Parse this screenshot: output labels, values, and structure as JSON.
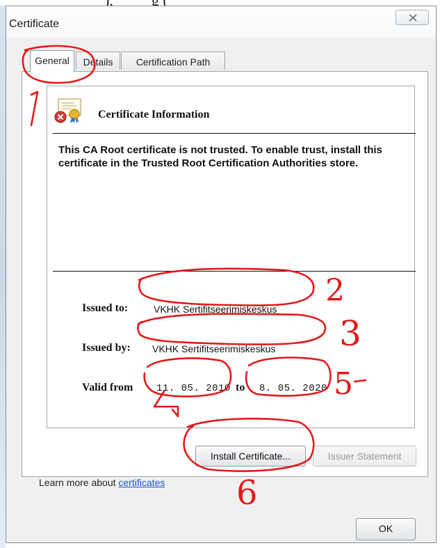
{
  "window": {
    "title": "Certificate"
  },
  "tabs": [
    {
      "label": "General",
      "active": true
    },
    {
      "label": "Details",
      "active": false
    },
    {
      "label": "Certification Path",
      "active": false
    }
  ],
  "info": {
    "heading": "Certificate Information",
    "message": "This CA Root certificate is not trusted. To enable trust, install this certificate in the Trusted Root Certification Authorities store."
  },
  "fields": {
    "issued_to_label": "Issued to:",
    "issued_to_value": "VKHK Sertifitseerimiskeskus",
    "issued_by_label": "Issued by:",
    "issued_by_value": "VKHK Sertifitseerimiskeskus",
    "valid_from_label": "Valid from",
    "valid_from_value": "11. 05. 2010",
    "valid_to_label": "to",
    "valid_to_value": "8. 05. 2020"
  },
  "buttons": {
    "install_label": "Install Certificate...",
    "issuer_statement_label": "Issuer Statement",
    "ok_label": "OK"
  },
  "learn_more": {
    "prefix": "Learn more about ",
    "link_text": "certificates"
  },
  "annotations": {
    "n1": "1",
    "n2": "2",
    "n3": "3",
    "n4": "4",
    "n5": "5",
    "n6": "6",
    "color": "#e11a1a"
  },
  "icons": {
    "certificate": "certificate-error-icon",
    "close": "close-icon"
  }
}
